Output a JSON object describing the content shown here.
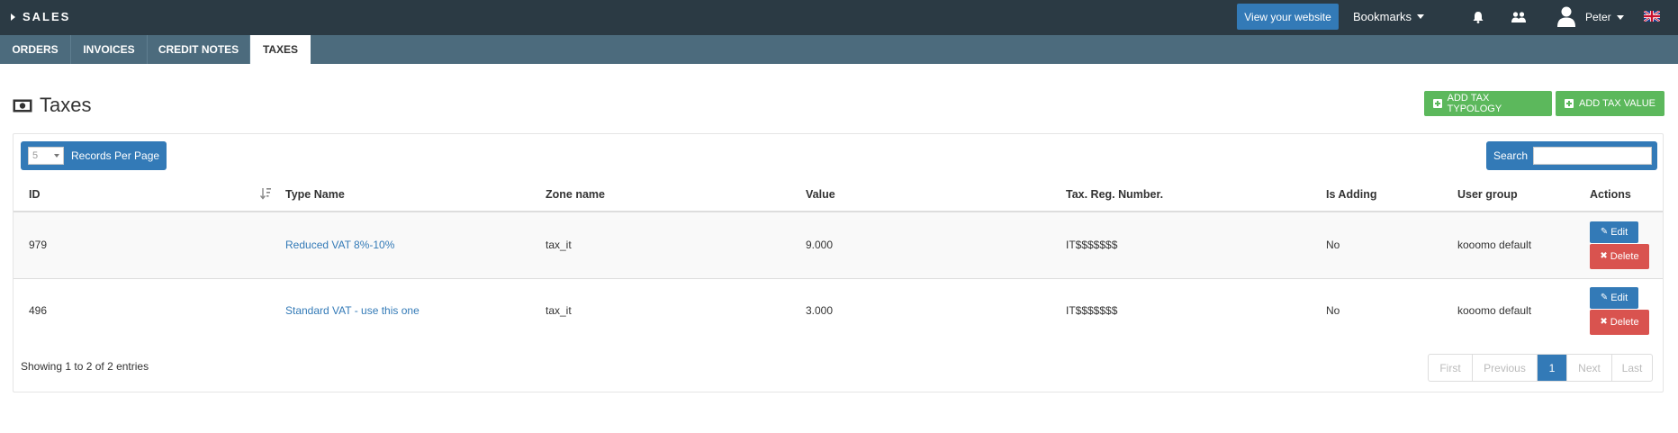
{
  "topbar": {
    "brand": "SALES",
    "view_website": "View your website",
    "bookmarks": "Bookmarks",
    "user": "Peter",
    "icons": [
      "caret-right-icon",
      "bell-icon",
      "users-icon",
      "user-avatar-icon",
      "uk-flag-icon"
    ]
  },
  "tabs": [
    {
      "label": "ORDERS",
      "active": false
    },
    {
      "label": "INVOICES",
      "active": false
    },
    {
      "label": "CREDIT NOTES",
      "active": false
    },
    {
      "label": "TAXES",
      "active": true
    }
  ],
  "page": {
    "title": "Taxes",
    "add_tax_typology": "ADD TAX TYPOLOGY",
    "add_tax_value": "ADD TAX VALUE"
  },
  "table": {
    "records_per_page_value": "5",
    "records_per_page_label": "Records Per Page",
    "search_label": "Search",
    "search_value": "",
    "headers": {
      "id": "ID",
      "type_name": "Type Name",
      "zone_name": "Zone name",
      "value": "Value",
      "tax_reg": "Tax. Reg. Number.",
      "is_adding": "Is Adding",
      "user_group": "User group",
      "actions": "Actions"
    },
    "rows": [
      {
        "id": "979",
        "type_name": "Reduced VAT 8%-10%",
        "zone_name": "tax_it",
        "value": "9.000",
        "tax_reg": "IT$$$$$$$",
        "is_adding": "No",
        "user_group": "kooomo default"
      },
      {
        "id": "496",
        "type_name": "Standard VAT - use this one",
        "zone_name": "tax_it",
        "value": "3.000",
        "tax_reg": "IT$$$$$$$",
        "is_adding": "No",
        "user_group": "kooomo default"
      }
    ],
    "edit_label": "Edit",
    "delete_label": "Delete",
    "showing": "Showing 1 to 2 of 2 entries",
    "pagination": {
      "first": "First",
      "previous": "Previous",
      "current": "1",
      "next": "Next",
      "last": "Last"
    }
  },
  "colors": {
    "topbar": "#2b3a44",
    "tabbar": "#4c6b7d",
    "primary": "#337ab7",
    "success": "#5cb85c",
    "danger": "#d9534f"
  }
}
